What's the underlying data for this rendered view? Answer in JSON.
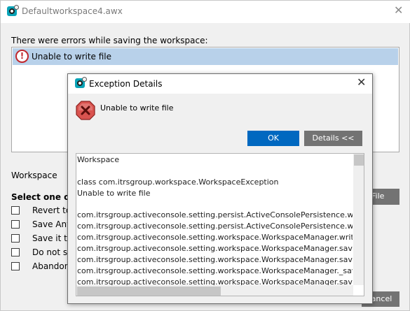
{
  "background_window": {
    "title": "Defaultworkspace4.awx",
    "close_glyph": "✕",
    "errors_label": "There were errors while saving the workspace:",
    "error_icon_glyph": "!",
    "error_item": "Unable to write file",
    "workspace_label": "Workspace",
    "file_button": "File",
    "select_label": "Select one of",
    "options": [
      "Revert to",
      "Save Any",
      "Save it to",
      "Do not sa",
      "Abandon"
    ],
    "cancel_button": "Cancel"
  },
  "exception_dialog": {
    "title": "Exception Details",
    "close_glyph": "✕",
    "message": "Unable to write file",
    "ok_button": "OK",
    "details_button": "Details <<",
    "details_lines": [
      "Workspace",
      "",
      "class com.itrsgroup.workspace.WorkspaceException",
      "Unable to write file",
      "",
      "com.itrsgroup.activeconsole.setting.persist.ActiveConsolePersistence.writeXml(",
      "com.itrsgroup.activeconsole.setting.persist.ActiveConsolePersistence.writeWorkspace(",
      "com.itrsgroup.activeconsole.setting.workspace.WorkspaceManager.writeWorkspace(",
      "com.itrsgroup.activeconsole.setting.workspace.WorkspaceManager.saveContent(",
      "com.itrsgroup.activeconsole.setting.workspace.WorkspaceManager.saveContent(",
      "com.itrsgroup.activeconsole.setting.workspace.WorkspaceManager._save(Wor",
      "com.itrsgroup.activeconsole.setting.workspace.WorkspaceManager.save(Wor"
    ]
  },
  "colors": {
    "app_icon": "#0aa3b7",
    "error_red": "#c1272d",
    "ok_button": "#0068c0",
    "secondary_button": "#737373",
    "selection": "#b8d1ea"
  }
}
